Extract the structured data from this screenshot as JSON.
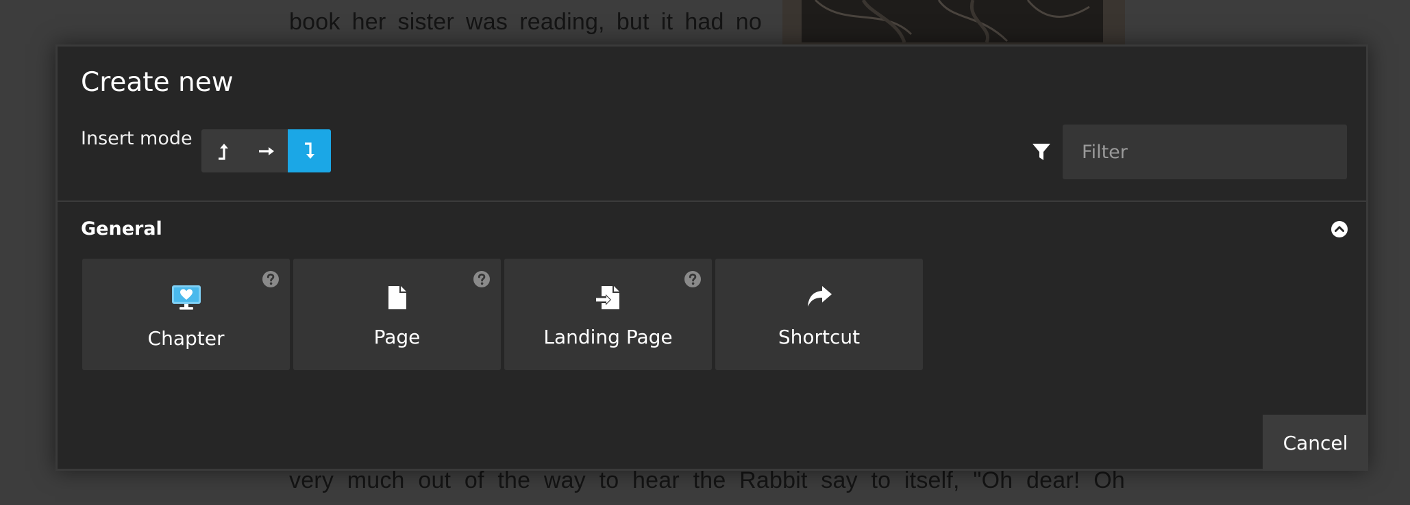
{
  "background": {
    "text_top": "book her sister was reading, but it had no",
    "text_bottom": "very much out of the way to hear the Rabbit say to itself, \"Oh dear! Oh"
  },
  "modal": {
    "title": "Create new",
    "insert_mode": {
      "label": "Insert mode",
      "options": [
        {
          "icon": "insert-before-icon",
          "active": false
        },
        {
          "icon": "insert-after-icon",
          "active": false
        },
        {
          "icon": "insert-child-icon",
          "active": true
        }
      ]
    },
    "filter": {
      "placeholder": "Filter",
      "value": ""
    },
    "section": {
      "title": "General",
      "collapse_icon": "chevron-up-circle-icon",
      "items": [
        {
          "label": "Chapter",
          "icon": "monitor-heart-icon",
          "has_help": true
        },
        {
          "label": "Page",
          "icon": "file-icon",
          "has_help": true
        },
        {
          "label": "Landing Page",
          "icon": "file-import-icon",
          "has_help": true
        },
        {
          "label": "Shortcut",
          "icon": "share-arrow-icon",
          "has_help": false
        }
      ]
    },
    "cancel_label": "Cancel"
  },
  "colors": {
    "accent": "#1ba7e6",
    "modal_bg": "#262626",
    "card_bg": "#353535"
  }
}
